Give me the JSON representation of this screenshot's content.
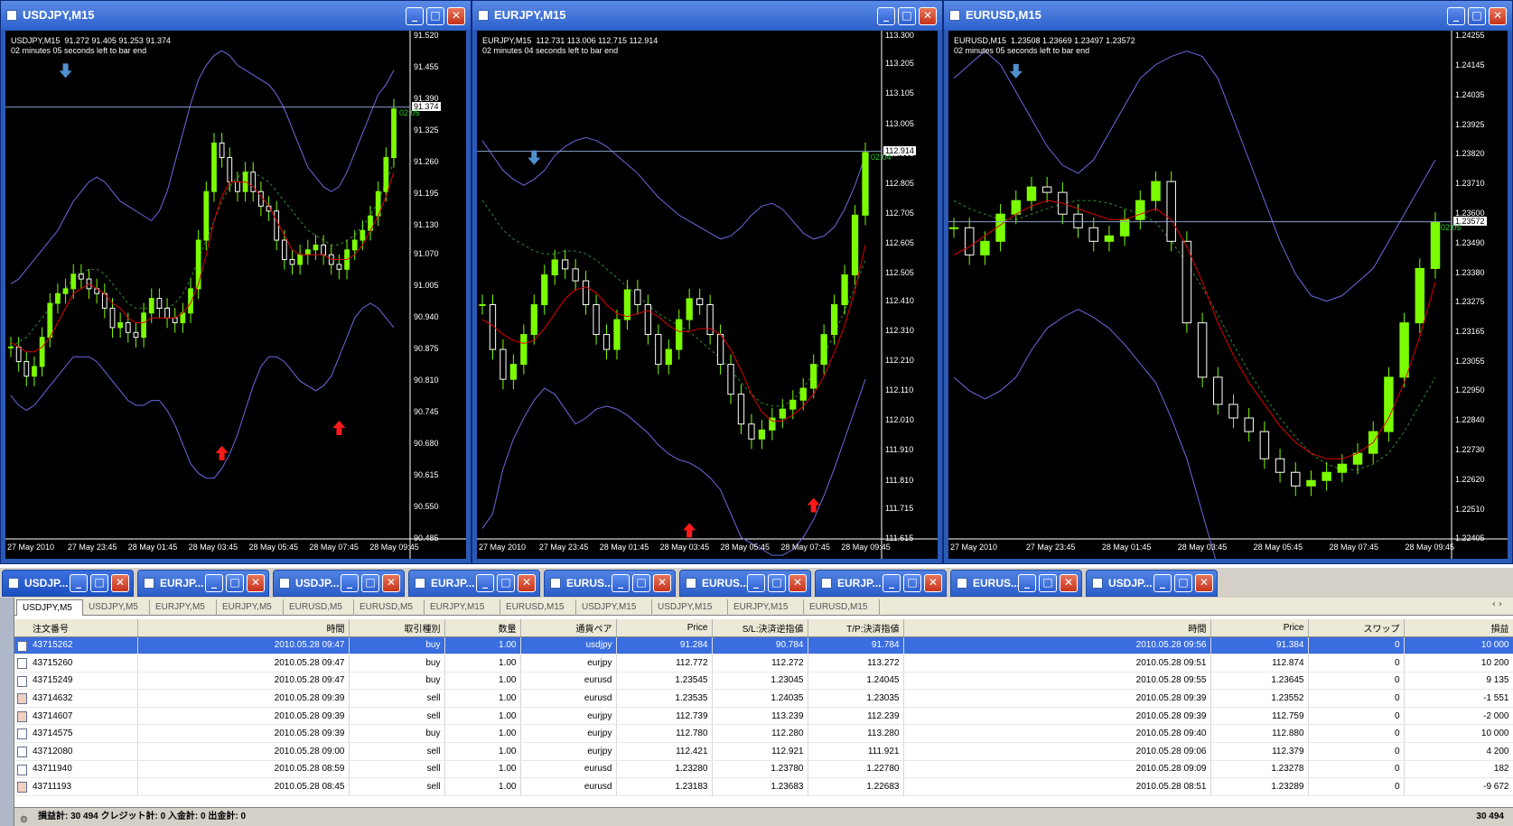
{
  "charts": [
    {
      "title": "USDJPY,M15",
      "info_line1": "USDJPY,M15  91.272 91.405 91.253 91.374",
      "info_line2": "02 minutes 05 seconds left to bar end",
      "current_price": "91.374",
      "timer": "02:05",
      "price_ticks": [
        "91.520",
        "91.455",
        "91.390",
        "91.325",
        "91.260",
        "91.195",
        "91.130",
        "91.070",
        "91.005",
        "90.940",
        "90.875",
        "90.810",
        "90.745",
        "90.680",
        "90.615",
        "90.550",
        "90.485"
      ],
      "time_ticks": [
        "27 May 2010",
        "27 May 23:45",
        "28 May 01:45",
        "28 May 03:45",
        "28 May 05:45",
        "28 May 07:45",
        "28 May 09:45"
      ],
      "close": [
        90.88,
        90.85,
        90.82,
        90.84,
        90.9,
        90.97,
        90.99,
        91.0,
        91.03,
        91.02,
        91.0,
        90.99,
        90.96,
        90.92,
        90.93,
        90.91,
        90.9,
        90.95,
        90.98,
        90.96,
        90.94,
        90.93,
        90.95,
        91.0,
        91.1,
        91.2,
        91.3,
        91.27,
        91.22,
        91.2,
        91.24,
        91.2,
        91.17,
        91.16,
        91.1,
        91.06,
        91.05,
        91.07,
        91.08,
        91.09,
        91.07,
        91.05,
        91.04,
        91.08,
        91.1,
        91.12,
        91.15,
        91.2,
        91.27,
        91.37
      ],
      "upper_band": [
        91.01,
        91.02,
        91.04,
        91.06,
        91.08,
        91.1,
        91.12,
        91.15,
        91.18,
        91.2,
        91.22,
        91.23,
        91.22,
        91.2,
        91.18,
        91.17,
        91.16,
        91.15,
        91.14,
        91.16,
        91.2,
        91.26,
        91.32,
        91.38,
        91.43,
        91.46,
        91.48,
        91.49,
        91.48,
        91.46,
        91.45,
        91.44,
        91.43,
        91.42,
        91.4,
        91.37,
        91.33,
        91.29,
        91.25,
        91.23,
        91.21,
        91.2,
        91.21,
        91.24,
        91.28,
        91.32,
        91.36,
        91.4,
        91.42,
        91.45
      ],
      "mid_band": [
        90.88,
        90.89,
        90.9,
        90.92,
        90.94,
        90.96,
        90.98,
        91.0,
        91.02,
        91.03,
        91.04,
        91.04,
        91.03,
        91.01,
        90.99,
        90.97,
        90.96,
        90.96,
        90.96,
        90.96,
        90.96,
        90.97,
        90.99,
        91.02,
        91.06,
        91.1,
        91.14,
        91.18,
        91.21,
        91.23,
        91.24,
        91.24,
        91.23,
        91.22,
        91.2,
        91.18,
        91.16,
        91.14,
        91.12,
        91.11,
        91.1,
        91.09,
        91.09,
        91.1,
        91.11,
        91.13,
        91.15,
        91.18,
        91.22,
        91.26
      ],
      "lower_band": [
        90.78,
        90.76,
        90.75,
        90.76,
        90.78,
        90.8,
        90.82,
        90.84,
        90.86,
        90.86,
        90.86,
        90.85,
        90.83,
        90.81,
        90.79,
        90.77,
        90.76,
        90.76,
        90.77,
        90.77,
        90.75,
        90.72,
        90.68,
        90.64,
        90.62,
        90.61,
        90.61,
        90.63,
        90.66,
        90.7,
        90.75,
        90.8,
        90.84,
        90.86,
        90.86,
        90.85,
        90.83,
        90.81,
        90.8,
        90.79,
        90.8,
        90.82,
        90.86,
        90.9,
        90.94,
        90.96,
        90.97,
        90.96,
        90.94,
        90.92
      ],
      "ma": [
        90.89,
        90.88,
        90.87,
        90.87,
        90.88,
        90.9,
        90.93,
        90.96,
        90.99,
        91.0,
        91.01,
        91.0,
        90.99,
        90.97,
        90.96,
        90.94,
        90.93,
        90.93,
        90.94,
        90.94,
        90.94,
        90.94,
        90.95,
        90.97,
        91.01,
        91.07,
        91.14,
        91.19,
        91.22,
        91.22,
        91.22,
        91.21,
        91.19,
        91.17,
        91.14,
        91.11,
        91.08,
        91.07,
        91.07,
        91.07,
        91.07,
        91.06,
        91.06,
        91.06,
        91.07,
        91.09,
        91.12,
        91.15,
        91.19,
        91.24
      ]
    },
    {
      "title": "EURJPY,M15",
      "info_line1": "EURJPY,M15  112.731 113.006 112.715 112.914",
      "info_line2": "02 minutes 04 seconds left to bar end",
      "current_price": "112.914",
      "timer": "02:04",
      "price_ticks": [
        "113.300",
        "113.205",
        "113.105",
        "113.005",
        "112.905",
        "112.805",
        "112.705",
        "112.605",
        "112.505",
        "112.410",
        "112.310",
        "112.210",
        "112.110",
        "112.010",
        "111.910",
        "111.810",
        "111.715",
        "111.615"
      ],
      "time_ticks": [
        "27 May 2010",
        "27 May 23:45",
        "28 May 01:45",
        "28 May 03:45",
        "28 May 05:45",
        "28 May 07:45",
        "28 May 09:45"
      ],
      "close": [
        112.4,
        112.25,
        112.15,
        112.2,
        112.3,
        112.4,
        112.5,
        112.55,
        112.52,
        112.48,
        112.4,
        112.3,
        112.25,
        112.35,
        112.45,
        112.4,
        112.3,
        112.2,
        112.25,
        112.35,
        112.42,
        112.4,
        112.3,
        112.2,
        112.1,
        112.0,
        111.95,
        111.98,
        112.02,
        112.05,
        112.08,
        112.12,
        112.2,
        112.3,
        112.4,
        112.5,
        112.7,
        112.91
      ],
      "upper_band": [
        112.95,
        112.9,
        112.85,
        112.82,
        112.8,
        112.82,
        112.85,
        112.9,
        112.93,
        112.95,
        112.96,
        112.95,
        112.93,
        112.9,
        112.87,
        112.84,
        112.8,
        112.76,
        112.73,
        112.7,
        112.68,
        112.66,
        112.64,
        112.62,
        112.63,
        112.66,
        112.7,
        112.73,
        112.74,
        112.72,
        112.68,
        112.64,
        112.62,
        112.63,
        112.66,
        112.72,
        112.8,
        112.9
      ],
      "mid_band": [
        112.75,
        112.7,
        112.65,
        112.62,
        112.6,
        112.58,
        112.57,
        112.57,
        112.58,
        112.58,
        112.57,
        112.55,
        112.52,
        112.49,
        112.46,
        112.43,
        112.4,
        112.37,
        112.35,
        112.33,
        112.31,
        112.28,
        112.25,
        112.22,
        112.18,
        112.14,
        112.1,
        112.07,
        112.06,
        112.06,
        112.08,
        112.12,
        112.17,
        112.23,
        112.3,
        112.38,
        112.46,
        112.55
      ],
      "lower_band": [
        111.65,
        111.7,
        111.85,
        111.95,
        112.02,
        112.08,
        112.12,
        112.1,
        112.05,
        112.0,
        112.02,
        112.05,
        112.06,
        112.05,
        112.03,
        112.0,
        111.97,
        111.93,
        111.9,
        111.88,
        111.87,
        111.85,
        111.82,
        111.78,
        111.7,
        111.62,
        111.6,
        111.58,
        111.56,
        111.56,
        111.58,
        111.62,
        111.68,
        111.76,
        111.85,
        111.95,
        112.05,
        112.15
      ],
      "ma": [
        112.35,
        112.33,
        112.3,
        112.28,
        112.27,
        112.28,
        112.32,
        112.37,
        112.42,
        112.45,
        112.46,
        112.44,
        112.4,
        112.37,
        112.36,
        112.37,
        112.38,
        112.36,
        112.33,
        112.31,
        112.31,
        112.32,
        112.32,
        112.3,
        112.25,
        112.18,
        112.1,
        112.04,
        112.01,
        112.01,
        112.03,
        112.06,
        112.1,
        112.16,
        112.24,
        112.33,
        112.45,
        112.6
      ]
    },
    {
      "title": "EURUSD,M15",
      "info_line1": "EURUSD,M15  1.23508 1.23669 1.23497 1.23572",
      "info_line2": "02 minutes 05 seconds left to bar end",
      "current_price": "1.23572",
      "timer": "02:05",
      "price_ticks": [
        "1.24255",
        "1.24145",
        "1.24035",
        "1.23925",
        "1.23820",
        "1.23710",
        "1.23600",
        "1.23490",
        "1.23380",
        "1.23275",
        "1.23165",
        "1.23055",
        "1.22950",
        "1.22840",
        "1.22730",
        "1.22620",
        "1.22510",
        "1.22405"
      ],
      "time_ticks": [
        "27 May 2010",
        "27 May 23:45",
        "28 May 01:45",
        "28 May 03:45",
        "28 May 05:45",
        "28 May 07:45",
        "28 May 09:45"
      ],
      "close": [
        1.2355,
        1.2345,
        1.235,
        1.236,
        1.2365,
        1.237,
        1.2368,
        1.236,
        1.2355,
        1.235,
        1.2352,
        1.2358,
        1.2365,
        1.2372,
        1.235,
        1.232,
        1.23,
        1.229,
        1.2285,
        1.228,
        1.227,
        1.2265,
        1.226,
        1.2262,
        1.2265,
        1.2268,
        1.2272,
        1.228,
        1.23,
        1.232,
        1.234,
        1.2357
      ],
      "upper_band": [
        1.241,
        1.2415,
        1.242,
        1.2415,
        1.2405,
        1.2395,
        1.2385,
        1.2378,
        1.2375,
        1.238,
        1.239,
        1.24,
        1.241,
        1.2415,
        1.2418,
        1.242,
        1.2418,
        1.241,
        1.2395,
        1.238,
        1.2365,
        1.235,
        1.2338,
        1.233,
        1.2328,
        1.233,
        1.2335,
        1.234,
        1.235,
        1.236,
        1.237,
        1.238
      ],
      "mid_band": [
        1.2365,
        1.2362,
        1.236,
        1.2358,
        1.2358,
        1.236,
        1.2362,
        1.2364,
        1.2365,
        1.2365,
        1.2364,
        1.2362,
        1.236,
        1.2357,
        1.235,
        1.2342,
        1.2333,
        1.2323,
        1.2312,
        1.2302,
        1.2293,
        1.2285,
        1.2278,
        1.2272,
        1.2268,
        1.2266,
        1.2266,
        1.2268,
        1.2272,
        1.228,
        1.229,
        1.23
      ],
      "lower_band": [
        1.23,
        1.2295,
        1.2292,
        1.2295,
        1.23,
        1.231,
        1.2318,
        1.2322,
        1.2325,
        1.2322,
        1.2318,
        1.2312,
        1.2305,
        1.2298,
        1.2285,
        1.227,
        1.225,
        1.223,
        1.221,
        1.219,
        1.2175,
        1.2165,
        1.216,
        1.2165,
        1.2175,
        1.219,
        1.2205,
        1.2215,
        1.222,
        1.2218,
        1.221,
        1.22
      ],
      "ma": [
        1.2345,
        1.2348,
        1.2352,
        1.2356,
        1.236,
        1.2363,
        1.2365,
        1.2364,
        1.2362,
        1.236,
        1.2358,
        1.2358,
        1.236,
        1.2362,
        1.2358,
        1.2348,
        1.2335,
        1.232,
        1.2308,
        1.2298,
        1.229,
        1.2282,
        1.2276,
        1.2272,
        1.227,
        1.227,
        1.2272,
        1.2276,
        1.2285,
        1.2298,
        1.2315,
        1.2335
      ]
    }
  ],
  "window_tabs": [
    "USDJP...",
    "EURJP...",
    "USDJP...",
    "EURJP...",
    "EURUS...",
    "EURUS...",
    "EURJP...",
    "EURUS...",
    "USDJP..."
  ],
  "symbol_tabs": [
    "USDJPY,M5",
    "USDJPY,M5",
    "EURJPY,M5",
    "EURJPY,M5",
    "EURUSD,M5",
    "EURUSD,M5",
    "EURJPY,M15",
    "EURUSD,M15",
    "USDJPY,M15",
    "USDJPY,M15",
    "EURJPY,M15",
    "EURUSD,M15"
  ],
  "table": {
    "headers": [
      "注文番号",
      "時間",
      "取引種別",
      "数量",
      "通貨ペア",
      "Price",
      "S/L:決済逆指値",
      "T/P:決済指値",
      "時間",
      "Price",
      "スワップ",
      "損益"
    ],
    "rows": [
      [
        "43715262",
        "2010.05.28 09:47",
        "buy",
        "1.00",
        "usdjpy",
        "91.284",
        "90.784",
        "91.784",
        "2010.05.28 09:56",
        "91.384",
        "0",
        "10 000"
      ],
      [
        "43715260",
        "2010.05.28 09:47",
        "buy",
        "1.00",
        "eurjpy",
        "112.772",
        "112.272",
        "113.272",
        "2010.05.28 09:51",
        "112.874",
        "0",
        "10 200"
      ],
      [
        "43715249",
        "2010.05.28 09:47",
        "buy",
        "1.00",
        "eurusd",
        "1.23545",
        "1.23045",
        "1.24045",
        "2010.05.28 09:55",
        "1.23645",
        "0",
        "9 135"
      ],
      [
        "43714632",
        "2010.05.28 09:39",
        "sell",
        "1.00",
        "eurusd",
        "1.23535",
        "1.24035",
        "1.23035",
        "2010.05.28 09:39",
        "1.23552",
        "0",
        "-1 551"
      ],
      [
        "43714607",
        "2010.05.28 09:39",
        "sell",
        "1.00",
        "eurjpy",
        "112.739",
        "113.239",
        "112.239",
        "2010.05.28 09:39",
        "112.759",
        "0",
        "-2 000"
      ],
      [
        "43714575",
        "2010.05.28 09:39",
        "buy",
        "1.00",
        "eurjpy",
        "112.780",
        "112.280",
        "113.280",
        "2010.05.28 09:40",
        "112.880",
        "0",
        "10 000"
      ],
      [
        "43712080",
        "2010.05.28 09:00",
        "sell",
        "1.00",
        "eurjpy",
        "112.421",
        "112.921",
        "111.921",
        "2010.05.28 09:06",
        "112.379",
        "0",
        "4 200"
      ],
      [
        "43711940",
        "2010.05.28 08:59",
        "sell",
        "1.00",
        "eurusd",
        "1.23280",
        "1.23780",
        "1.22780",
        "2010.05.28 09:09",
        "1.23278",
        "0",
        "182"
      ],
      [
        "43711193",
        "2010.05.28 08:45",
        "sell",
        "1.00",
        "eurusd",
        "1.23183",
        "1.23683",
        "1.22683",
        "2010.05.28 08:51",
        "1.23289",
        "0",
        "-9 672"
      ]
    ]
  },
  "status": {
    "summary": "損益計: 30 494  クレジット計: 0  入金計: 0  出金計: 0",
    "total": "30 494"
  },
  "colors": {
    "bull": "#7cfc00",
    "bear": "#ffffff",
    "band": "#6a6ae0",
    "mid": "#2e8b2e",
    "ma": "#e00000",
    "arrow_up_red": "#ff1a1a",
    "arrow_down_blue": "#5090d0"
  }
}
